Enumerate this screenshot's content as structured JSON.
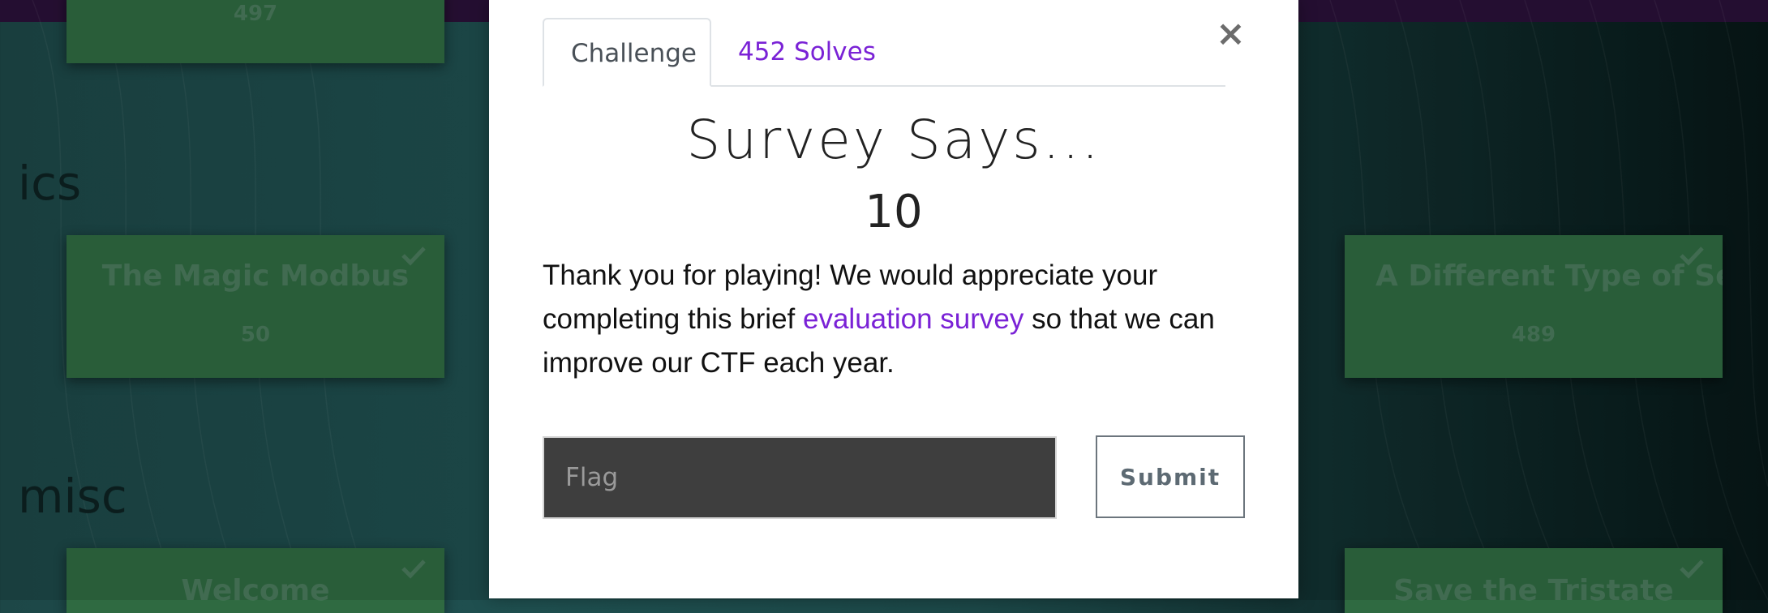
{
  "background": {
    "sections": [
      {
        "title": "ics"
      },
      {
        "title": "misc"
      }
    ],
    "cards": [
      {
        "name": "",
        "points": "497",
        "solved": false
      },
      {
        "name": "The Magic Modbus",
        "points": "50",
        "solved": true
      },
      {
        "name": "A Different Type of Seri",
        "points": "489",
        "solved": true
      },
      {
        "name": "Welcome",
        "points": "",
        "solved": true
      },
      {
        "name": "Save the Tristate",
        "points": "",
        "solved": true
      }
    ]
  },
  "modal": {
    "tabs": [
      {
        "label": "Challenge",
        "active": true
      },
      {
        "label": "452 Solves",
        "active": false
      }
    ],
    "close_symbol": "×",
    "title": "Survey Says...",
    "value": "10",
    "description": {
      "before_link": "Thank you for playing! We would appreciate your completing this brief ",
      "link_text": "evaluation survey",
      "after_link": " so that we can improve our CTF each year."
    },
    "flag_input": {
      "placeholder": "Flag",
      "value": ""
    },
    "submit_label": "Submit"
  },
  "colors": {
    "accent": "#7a22d6",
    "topbar": "#2a1138",
    "card": "#2f6a41"
  }
}
